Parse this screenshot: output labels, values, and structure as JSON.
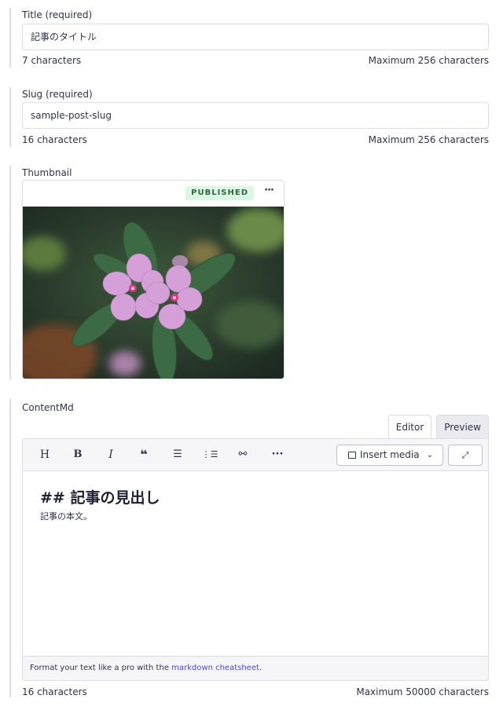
{
  "title_field": {
    "label": "Title (required)",
    "value": "記事のタイトル",
    "count": "7 characters",
    "max": "Maximum 256 characters"
  },
  "slug_field": {
    "label": "Slug (required)",
    "value": "sample-post-slug",
    "count": "16 characters",
    "max": "Maximum 256 characters"
  },
  "thumbnail_field": {
    "label": "Thumbnail",
    "badge": "PUBLISHED",
    "more_label": "···",
    "image_icon": "flower-photo"
  },
  "content_field": {
    "label": "ContentMd",
    "tabs": {
      "editor": "Editor",
      "preview": "Preview"
    },
    "toolbar": {
      "heading": "H",
      "bold": "B",
      "italic": "I",
      "quote": "❝",
      "bullet_list": "☰",
      "numbered_list": "⋮☰",
      "link": "⚯",
      "more": "···",
      "insert_media": "Insert media",
      "expand": "⤢"
    },
    "preview_heading": "## 記事の見出し",
    "preview_body": "記事の本文。",
    "footer_prefix": "Format your text like a pro with the ",
    "footer_link": "markdown cheatsheet",
    "footer_suffix": ".",
    "count": "16 characters",
    "max": "Maximum 50000 characters"
  },
  "colors": {
    "badge_bg": "#dcf7e4",
    "badge_text": "#2f6846",
    "link": "#4945ff",
    "border": "#dcdce4"
  }
}
